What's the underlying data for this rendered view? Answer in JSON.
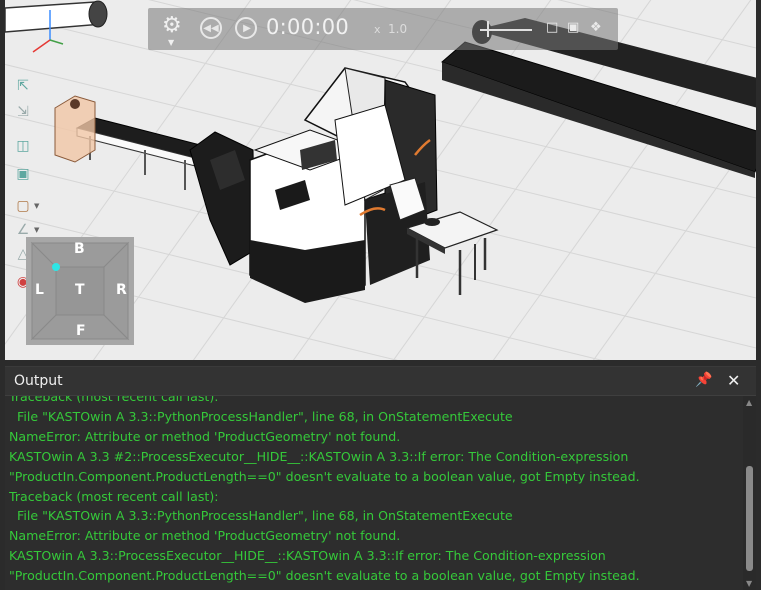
{
  "playback": {
    "time": "0:00:00",
    "speed_prefix": "x",
    "speed": "1.0"
  },
  "viewcube": {
    "top": "T",
    "back": "B",
    "front": "F",
    "left": "L",
    "right": "R"
  },
  "output": {
    "title": "Output",
    "lines": [
      "Traceback (most recent call last):",
      "  File \"KASTOwin A 3.3::PythonProcessHandler\", line 68, in OnStatementExecute",
      "NameError: Attribute or method 'ProductGeometry' not found.",
      "KASTOwin A 3.3 #2::ProcessExecutor__HIDE__::KASTOwin A 3.3::If error: The Condition-expression",
      "\"ProductIn.Component.ProductLength==0\" doesn't evaluate to a boolean value, got Empty instead.",
      "Traceback (most recent call last):",
      "  File \"KASTOwin A 3.3::PythonProcessHandler\", line 68, in OnStatementExecute",
      "NameError: Attribute or method 'ProductGeometry' not found.",
      "KASTOwin A 3.3::ProcessExecutor__HIDE__::KASTOwin A 3.3::If error: The Condition-expression",
      "\"ProductIn.Component.ProductLength==0\" doesn't evaluate to a boolean value, got Empty instead."
    ]
  },
  "colors": {
    "log_text": "#35c93a",
    "accent_cyan": "#2ee6e6",
    "viewport_bg": "#ececec"
  },
  "icons": {
    "settings": "gear-icon",
    "rewind": "rewind-icon",
    "play": "play-icon",
    "pdf": "pdf-icon",
    "video": "video-camera-icon",
    "network": "network-icon",
    "pin": "pin-icon",
    "close": "close-icon"
  }
}
